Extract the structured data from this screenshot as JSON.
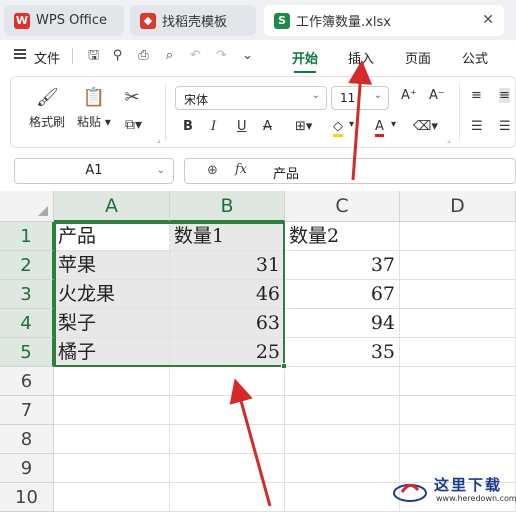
{
  "tabs": [
    {
      "name": "tab-wps-office",
      "label": "WPS Office",
      "icon_color": "#e0312c"
    },
    {
      "name": "tab-template",
      "label": "找稻壳模板",
      "icon_color": "#d93a32"
    },
    {
      "name": "tab-workbook",
      "label": "工作簿数量.xlsx",
      "icon_color": "#1f8a4c"
    }
  ],
  "menu": {
    "file": "文件",
    "tabs": [
      "开始",
      "插入",
      "页面",
      "公式"
    ],
    "active_tab": "开始"
  },
  "ribbon": {
    "format_painter": "格式刷",
    "paste": "粘贴",
    "font_name": "宋体",
    "font_size": "11"
  },
  "formula_bar": {
    "cell_ref": "A1",
    "fx": "fx",
    "value": "产品"
  },
  "sheet": {
    "columns": [
      "A",
      "B",
      "C",
      "D"
    ],
    "rows": [
      "1",
      "2",
      "3",
      "4",
      "5",
      "6",
      "7",
      "8",
      "9",
      "10"
    ],
    "cells": [
      [
        "产品",
        "数量1",
        "数量2"
      ],
      [
        "苹果",
        "31",
        "37"
      ],
      [
        "火龙果",
        "46",
        "67"
      ],
      [
        "梨子",
        "63",
        "94"
      ],
      [
        "橘子",
        "25",
        "35"
      ]
    ],
    "selected_range": "A1:B5"
  },
  "colors": {
    "accent_green": "#0d7a3f",
    "selection_border": "#2f7d3b",
    "arrow_red": "#d42a2a"
  },
  "watermark": {
    "title": "这里下载",
    "url": "www.heredown.com"
  }
}
